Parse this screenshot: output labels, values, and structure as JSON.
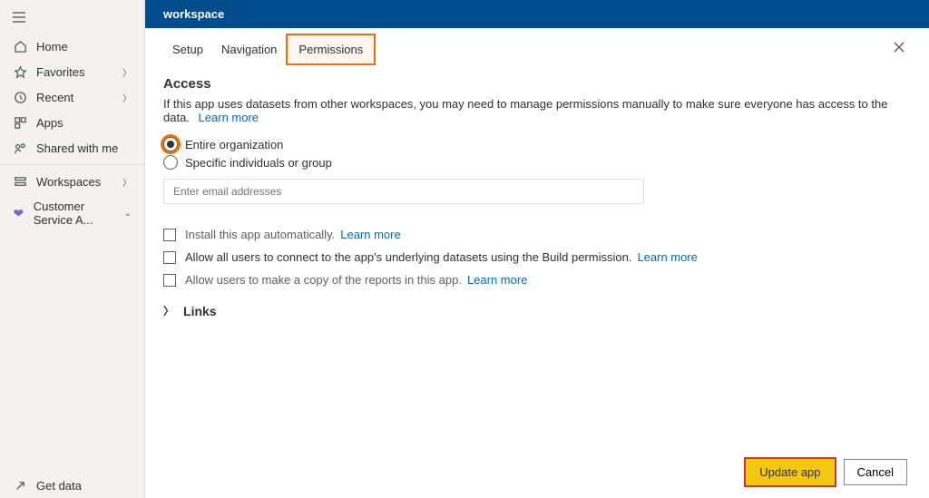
{
  "sidebar": {
    "items": [
      {
        "label": "Home"
      },
      {
        "label": "Favorites"
      },
      {
        "label": "Recent"
      },
      {
        "label": "Apps"
      },
      {
        "label": "Shared with me"
      },
      {
        "label": "Workspaces"
      },
      {
        "label": "Customer Service A..."
      }
    ],
    "footer": {
      "label": "Get data"
    }
  },
  "titlebar": {
    "title": "workspace"
  },
  "tabs": {
    "setup": "Setup",
    "navigation": "Navigation",
    "permissions": "Permissions"
  },
  "access": {
    "heading": "Access",
    "info": "If this app uses datasets from other workspaces, you may need to manage permissions manually to make sure everyone has access to the data.",
    "learn": "Learn more",
    "radio_org": "Entire organization",
    "radio_specific": "Specific individuals or group",
    "email_placeholder": "Enter email addresses",
    "check_install": "Install this app automatically.",
    "check_install_learn": "Learn more",
    "check_allow_build": "Allow all users to connect to the app's underlying datasets using the Build permission.",
    "check_allow_build_learn": "Learn more",
    "check_copy": "Allow users to make a copy of the reports in this app.",
    "check_copy_learn": "Learn more"
  },
  "links": {
    "label": "Links"
  },
  "buttons": {
    "update": "Update app",
    "cancel": "Cancel"
  }
}
